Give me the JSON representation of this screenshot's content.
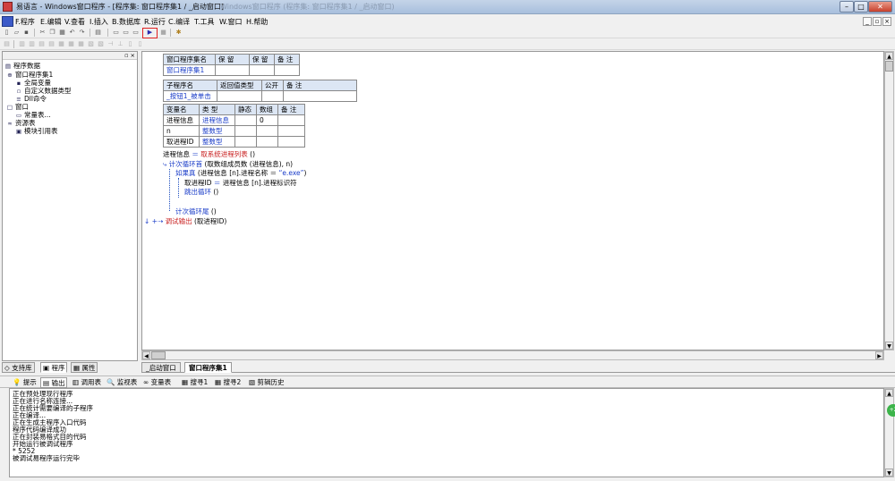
{
  "window": {
    "title": "易语言 - Windows窗口程序 - [程序集: 窗口程序集1 / _启动窗口]",
    "title_faded": "Windows窗口程序 (程序集: 窗口程序集1 / _启动窗口)",
    "buttons": {
      "minimize": "–",
      "maximize": "□",
      "close": "✕"
    }
  },
  "menu": [
    "F.程序",
    "E.编辑",
    "V.查看",
    "I.插入",
    "B.数据库",
    "R.运行",
    "C.编译",
    "T.工具",
    "W.窗口",
    "H.帮助"
  ],
  "mdi_buttons": [
    "_",
    "▫",
    "×"
  ],
  "panel_close": "▫ ×",
  "tree": [
    {
      "label": "程序数据",
      "icon": "▤"
    },
    {
      "label": "窗口程序集1",
      "icon": "⊕"
    },
    {
      "label": "全局变量",
      "icon": "▪"
    },
    {
      "label": "自定义数据类型",
      "icon": "▫"
    },
    {
      "label": "Dll命令",
      "icon": "≡"
    },
    {
      "label": "窗口",
      "icon": "□"
    },
    {
      "label": "常量表...",
      "icon": "▭"
    },
    {
      "label": "资源表",
      "icon": "∞"
    },
    {
      "label": "模块引用表",
      "icon": "▣"
    }
  ],
  "left_tabs": [
    "支持库",
    "程序",
    "属性"
  ],
  "doc_tabs": [
    "_启动窗口",
    "窗口程序集1"
  ],
  "assembly_table": {
    "headers": [
      "窗口程序集名",
      "保 留",
      "保 留",
      "备 注"
    ],
    "row": [
      "窗口程序集1",
      "",
      "",
      ""
    ]
  },
  "sub_table": {
    "headers": [
      "子程序名",
      "返回值类型",
      "公开",
      "备 注"
    ],
    "row": [
      "_按钮1_被单击",
      "",
      "",
      ""
    ]
  },
  "var_table": {
    "headers": [
      "变量名",
      "类 型",
      "静态",
      "数组",
      "备 注"
    ],
    "rows": [
      [
        "进程信息",
        "进程信息",
        "",
        "0",
        ""
      ],
      [
        "n",
        "整数型",
        "",
        "",
        ""
      ],
      [
        "取进程ID",
        "整数型",
        "",
        "",
        ""
      ]
    ]
  },
  "code": [
    {
      "pre": "进程信息 ",
      "op": "＝",
      "call": "取系统进程列表",
      "post": " ()"
    },
    {
      "kw": "计次循环首",
      "post": " (取数组成员数 (进程信息), n)"
    },
    {
      "kw": "如果真",
      "post": " (进程信息 [n].进程名称 ＝ ",
      "str": "“e.exe”",
      "tail": ")"
    },
    {
      "pre": "取进程ID ",
      "op": "＝",
      "post": " 进程信息 [n].进程标识符"
    },
    {
      "kw": "跳出循环",
      "post": " ()"
    },
    {
      "kw": "计次循环尾",
      "post": " ()"
    },
    {
      "call": "调试输出",
      "post": " (取进程ID)"
    }
  ],
  "bottom_tabs": [
    "提示",
    "输出",
    "调用表",
    "监视表",
    "变量表",
    "搜寻1",
    "搜寻2",
    "剪辑历史"
  ],
  "output_lines": [
    "正在预处理现行程序",
    "正在进行名称连接...",
    "正在统计需要编译的子程序",
    "正在编译...",
    "正在生成主程序入口代码",
    "程序代码编译成功",
    "正在封装易格式目的代码",
    "开始运行被调试程序",
    "* 5252",
    "被调试易程序运行完毕"
  ],
  "badge": "+2"
}
